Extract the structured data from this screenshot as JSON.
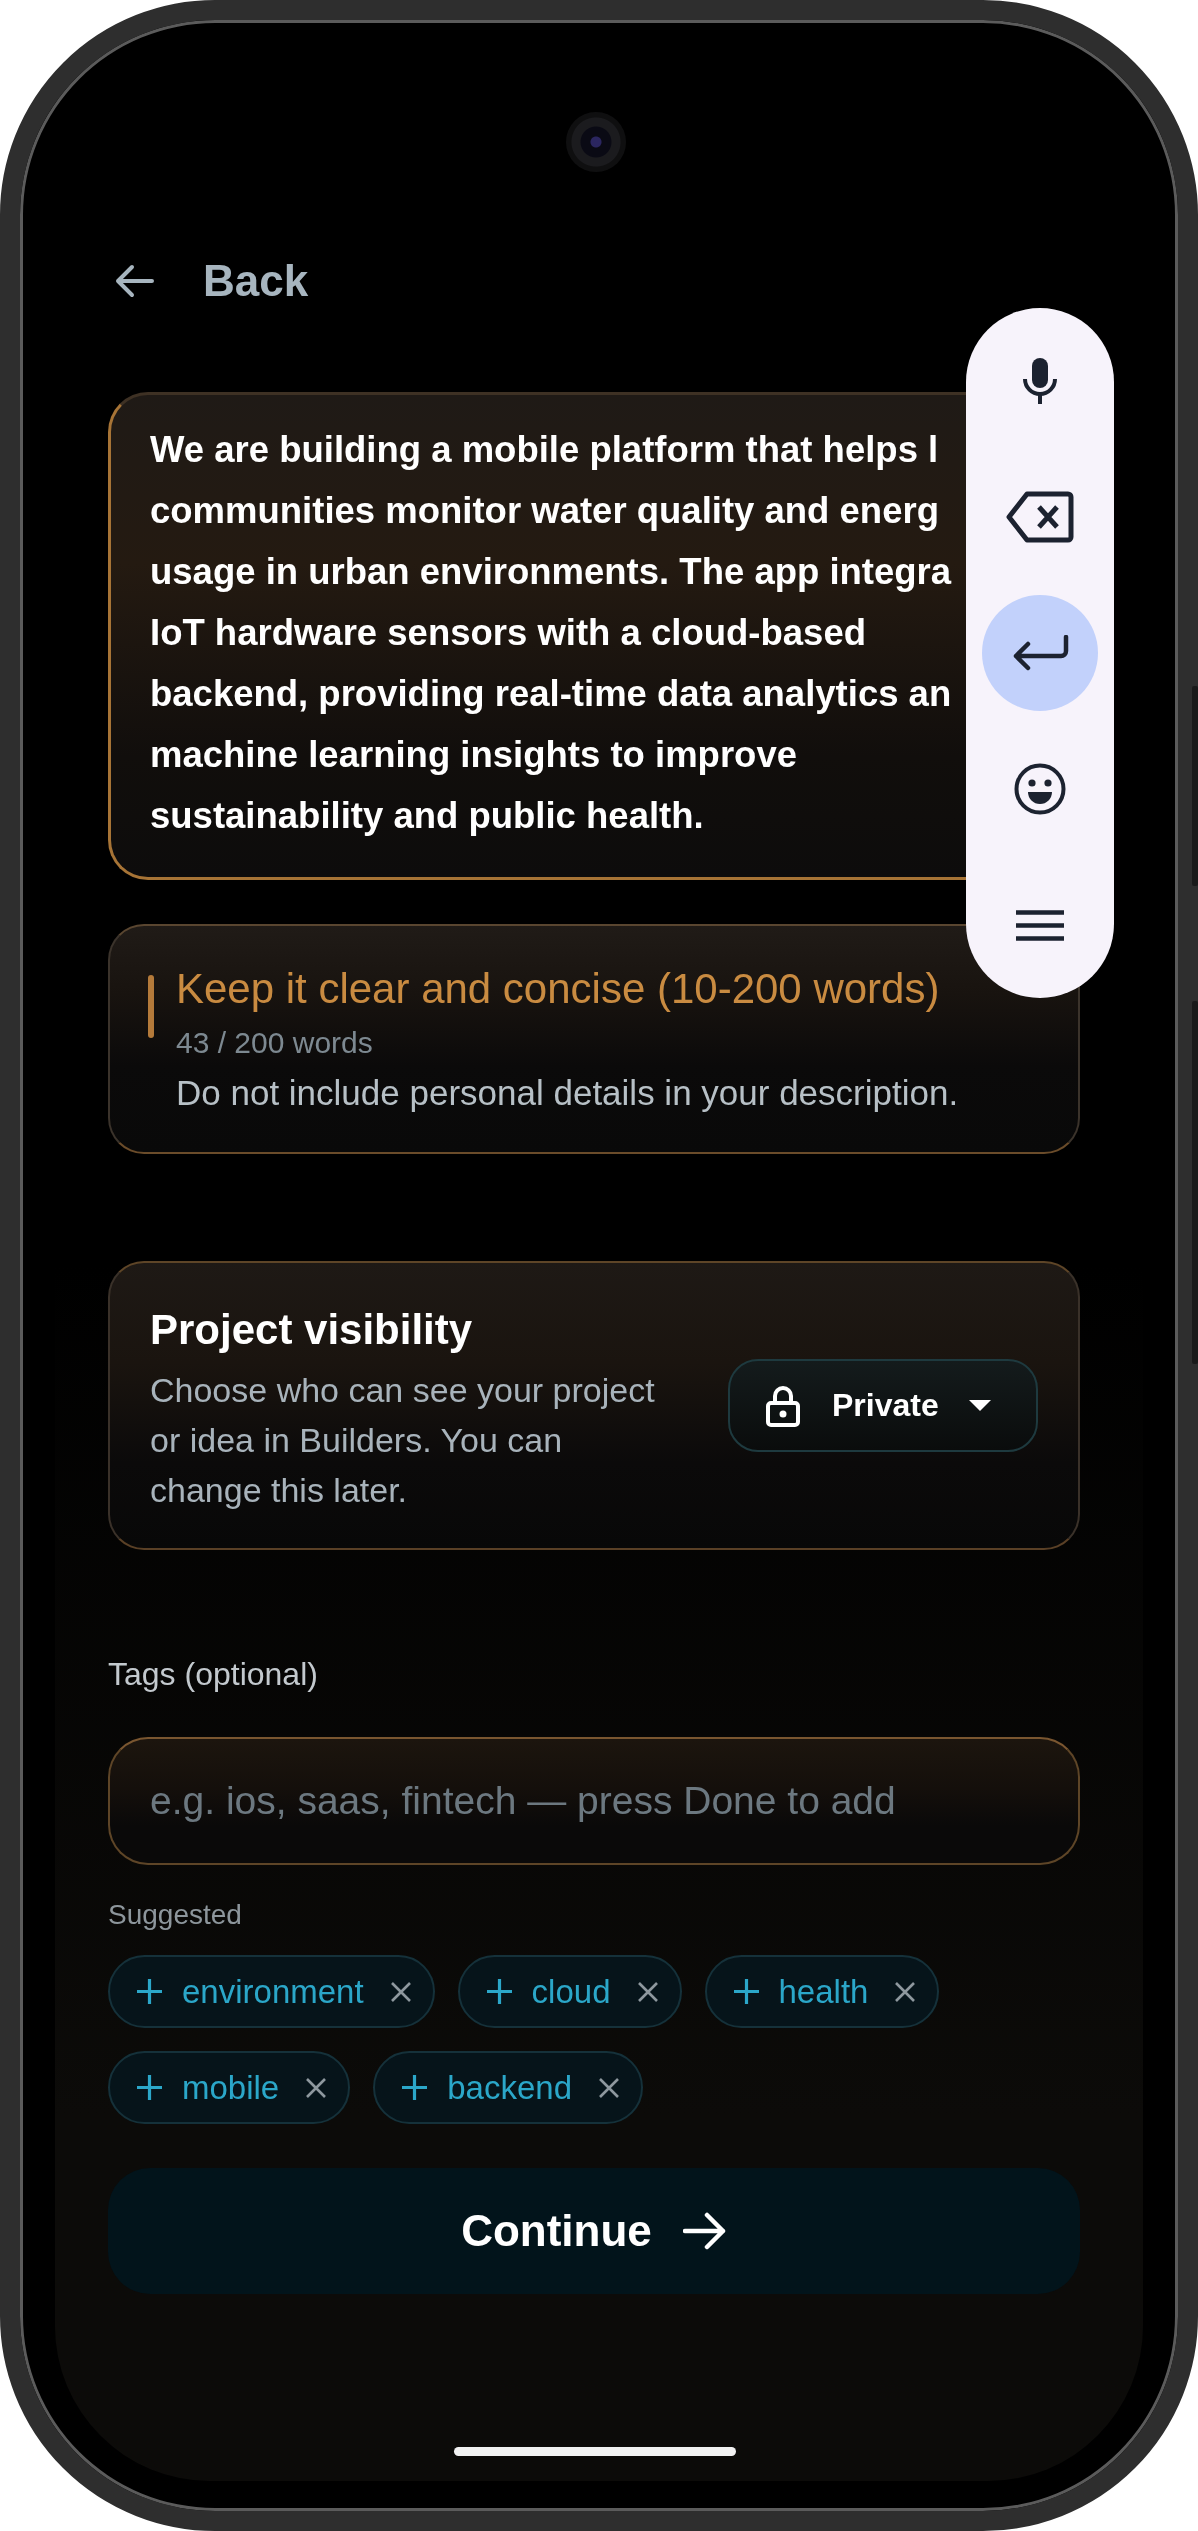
{
  "header": {
    "back_label": "Back"
  },
  "description": {
    "lines": [
      "We are building a mobile platform that helps l",
      "communities monitor water quality and energ",
      "usage in urban environments. The app integra",
      "IoT hardware sensors with a cloud-based",
      "backend, providing real-time data analytics an",
      "machine learning insights to improve",
      "sustainability and public health."
    ]
  },
  "hint": {
    "title": "Keep it clear and concise (10-200 words)",
    "count": "43 / 200 words",
    "note": "Do not include personal details in your description."
  },
  "visibility": {
    "title": "Project visibility",
    "text": "Choose who can see your project or idea in Builders. You can change this later.",
    "dropdown": {
      "value": "Private"
    }
  },
  "tags": {
    "label": "Tags (optional)",
    "placeholder": "e.g. ios, saas, fintech — press Done to add",
    "suggested_label": "Suggested",
    "suggestions": [
      {
        "label": "environment"
      },
      {
        "label": "cloud"
      },
      {
        "label": "health"
      },
      {
        "label": "mobile"
      },
      {
        "label": "backend"
      }
    ]
  },
  "continue_button": {
    "label": "Continue"
  }
}
